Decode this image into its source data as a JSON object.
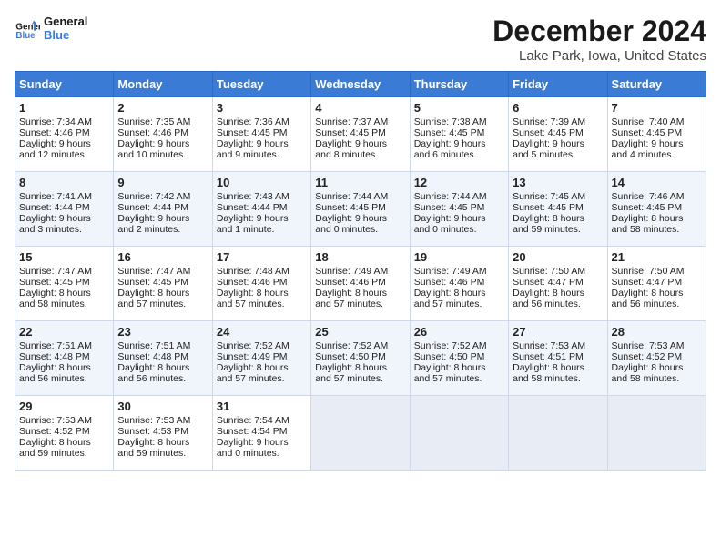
{
  "header": {
    "logo_line1": "General",
    "logo_line2": "Blue",
    "title": "December 2024",
    "subtitle": "Lake Park, Iowa, United States"
  },
  "weekdays": [
    "Sunday",
    "Monday",
    "Tuesday",
    "Wednesday",
    "Thursday",
    "Friday",
    "Saturday"
  ],
  "weeks": [
    [
      {
        "day": "1",
        "lines": [
          "Sunrise: 7:34 AM",
          "Sunset: 4:46 PM",
          "Daylight: 9 hours",
          "and 12 minutes."
        ]
      },
      {
        "day": "2",
        "lines": [
          "Sunrise: 7:35 AM",
          "Sunset: 4:46 PM",
          "Daylight: 9 hours",
          "and 10 minutes."
        ]
      },
      {
        "day": "3",
        "lines": [
          "Sunrise: 7:36 AM",
          "Sunset: 4:45 PM",
          "Daylight: 9 hours",
          "and 9 minutes."
        ]
      },
      {
        "day": "4",
        "lines": [
          "Sunrise: 7:37 AM",
          "Sunset: 4:45 PM",
          "Daylight: 9 hours",
          "and 8 minutes."
        ]
      },
      {
        "day": "5",
        "lines": [
          "Sunrise: 7:38 AM",
          "Sunset: 4:45 PM",
          "Daylight: 9 hours",
          "and 6 minutes."
        ]
      },
      {
        "day": "6",
        "lines": [
          "Sunrise: 7:39 AM",
          "Sunset: 4:45 PM",
          "Daylight: 9 hours",
          "and 5 minutes."
        ]
      },
      {
        "day": "7",
        "lines": [
          "Sunrise: 7:40 AM",
          "Sunset: 4:45 PM",
          "Daylight: 9 hours",
          "and 4 minutes."
        ]
      }
    ],
    [
      {
        "day": "8",
        "lines": [
          "Sunrise: 7:41 AM",
          "Sunset: 4:44 PM",
          "Daylight: 9 hours",
          "and 3 minutes."
        ]
      },
      {
        "day": "9",
        "lines": [
          "Sunrise: 7:42 AM",
          "Sunset: 4:44 PM",
          "Daylight: 9 hours",
          "and 2 minutes."
        ]
      },
      {
        "day": "10",
        "lines": [
          "Sunrise: 7:43 AM",
          "Sunset: 4:44 PM",
          "Daylight: 9 hours",
          "and 1 minute."
        ]
      },
      {
        "day": "11",
        "lines": [
          "Sunrise: 7:44 AM",
          "Sunset: 4:45 PM",
          "Daylight: 9 hours",
          "and 0 minutes."
        ]
      },
      {
        "day": "12",
        "lines": [
          "Sunrise: 7:44 AM",
          "Sunset: 4:45 PM",
          "Daylight: 9 hours",
          "and 0 minutes."
        ]
      },
      {
        "day": "13",
        "lines": [
          "Sunrise: 7:45 AM",
          "Sunset: 4:45 PM",
          "Daylight: 8 hours",
          "and 59 minutes."
        ]
      },
      {
        "day": "14",
        "lines": [
          "Sunrise: 7:46 AM",
          "Sunset: 4:45 PM",
          "Daylight: 8 hours",
          "and 58 minutes."
        ]
      }
    ],
    [
      {
        "day": "15",
        "lines": [
          "Sunrise: 7:47 AM",
          "Sunset: 4:45 PM",
          "Daylight: 8 hours",
          "and 58 minutes."
        ]
      },
      {
        "day": "16",
        "lines": [
          "Sunrise: 7:47 AM",
          "Sunset: 4:45 PM",
          "Daylight: 8 hours",
          "and 57 minutes."
        ]
      },
      {
        "day": "17",
        "lines": [
          "Sunrise: 7:48 AM",
          "Sunset: 4:46 PM",
          "Daylight: 8 hours",
          "and 57 minutes."
        ]
      },
      {
        "day": "18",
        "lines": [
          "Sunrise: 7:49 AM",
          "Sunset: 4:46 PM",
          "Daylight: 8 hours",
          "and 57 minutes."
        ]
      },
      {
        "day": "19",
        "lines": [
          "Sunrise: 7:49 AM",
          "Sunset: 4:46 PM",
          "Daylight: 8 hours",
          "and 57 minutes."
        ]
      },
      {
        "day": "20",
        "lines": [
          "Sunrise: 7:50 AM",
          "Sunset: 4:47 PM",
          "Daylight: 8 hours",
          "and 56 minutes."
        ]
      },
      {
        "day": "21",
        "lines": [
          "Sunrise: 7:50 AM",
          "Sunset: 4:47 PM",
          "Daylight: 8 hours",
          "and 56 minutes."
        ]
      }
    ],
    [
      {
        "day": "22",
        "lines": [
          "Sunrise: 7:51 AM",
          "Sunset: 4:48 PM",
          "Daylight: 8 hours",
          "and 56 minutes."
        ]
      },
      {
        "day": "23",
        "lines": [
          "Sunrise: 7:51 AM",
          "Sunset: 4:48 PM",
          "Daylight: 8 hours",
          "and 56 minutes."
        ]
      },
      {
        "day": "24",
        "lines": [
          "Sunrise: 7:52 AM",
          "Sunset: 4:49 PM",
          "Daylight: 8 hours",
          "and 57 minutes."
        ]
      },
      {
        "day": "25",
        "lines": [
          "Sunrise: 7:52 AM",
          "Sunset: 4:50 PM",
          "Daylight: 8 hours",
          "and 57 minutes."
        ]
      },
      {
        "day": "26",
        "lines": [
          "Sunrise: 7:52 AM",
          "Sunset: 4:50 PM",
          "Daylight: 8 hours",
          "and 57 minutes."
        ]
      },
      {
        "day": "27",
        "lines": [
          "Sunrise: 7:53 AM",
          "Sunset: 4:51 PM",
          "Daylight: 8 hours",
          "and 58 minutes."
        ]
      },
      {
        "day": "28",
        "lines": [
          "Sunrise: 7:53 AM",
          "Sunset: 4:52 PM",
          "Daylight: 8 hours",
          "and 58 minutes."
        ]
      }
    ],
    [
      {
        "day": "29",
        "lines": [
          "Sunrise: 7:53 AM",
          "Sunset: 4:52 PM",
          "Daylight: 8 hours",
          "and 59 minutes."
        ]
      },
      {
        "day": "30",
        "lines": [
          "Sunrise: 7:53 AM",
          "Sunset: 4:53 PM",
          "Daylight: 8 hours",
          "and 59 minutes."
        ]
      },
      {
        "day": "31",
        "lines": [
          "Sunrise: 7:54 AM",
          "Sunset: 4:54 PM",
          "Daylight: 9 hours",
          "and 0 minutes."
        ]
      },
      {
        "day": "",
        "lines": []
      },
      {
        "day": "",
        "lines": []
      },
      {
        "day": "",
        "lines": []
      },
      {
        "day": "",
        "lines": []
      }
    ]
  ]
}
